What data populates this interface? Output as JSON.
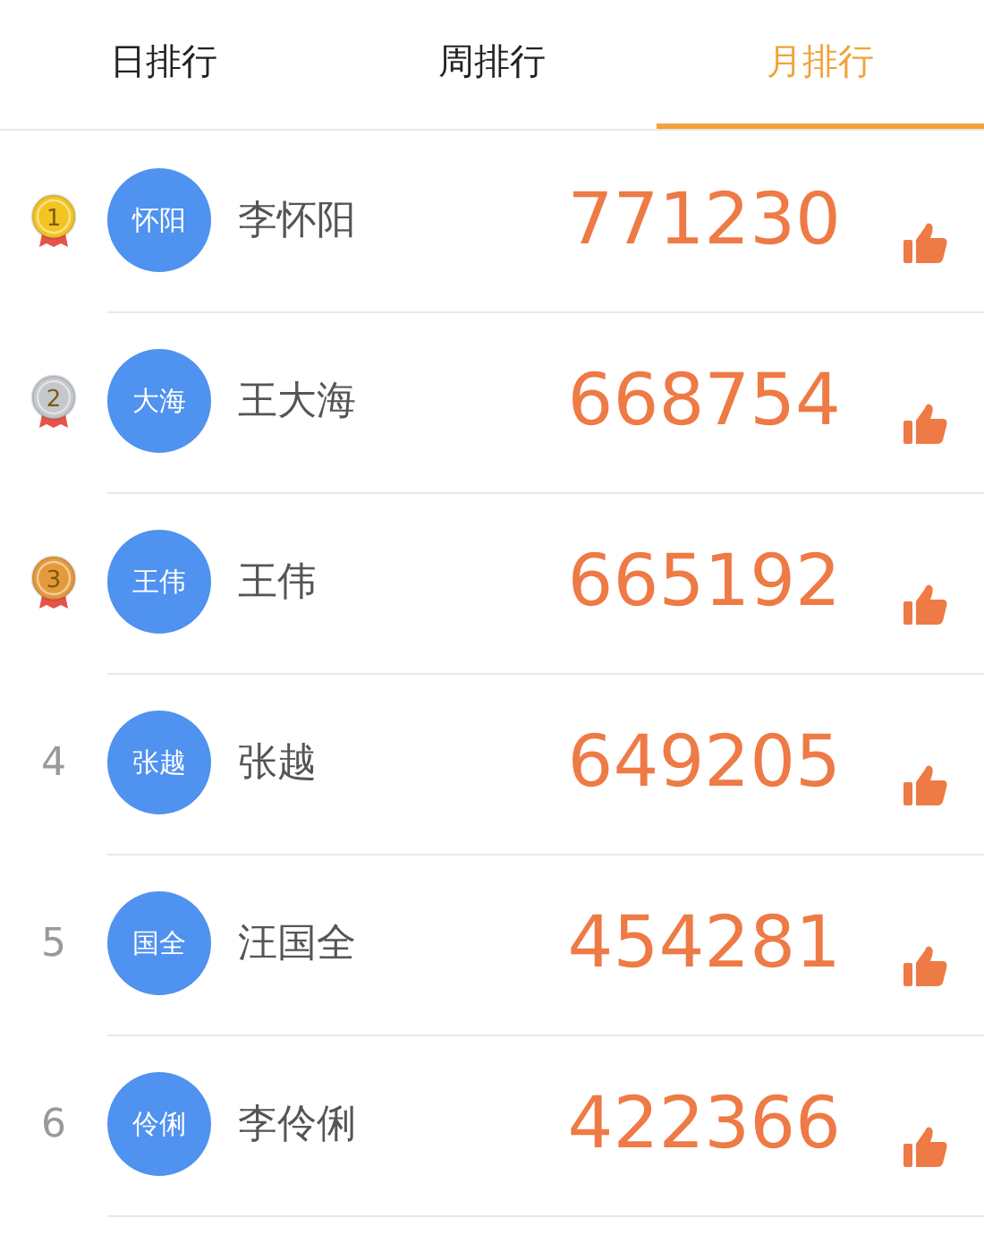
{
  "tabs": [
    {
      "label": "日排行",
      "selected": false
    },
    {
      "label": "周排行",
      "selected": false
    },
    {
      "label": "月排行",
      "selected": true
    }
  ],
  "rows": [
    {
      "kind": "medal",
      "rank": "1",
      "color": "#f2c522",
      "avatar": "怀阳",
      "name": "李怀阳",
      "score": "771230"
    },
    {
      "kind": "medal",
      "rank": "2",
      "color": "#c4c8cc",
      "avatar": "大海",
      "name": "王大海",
      "score": "668754"
    },
    {
      "kind": "medal",
      "rank": "3",
      "color": "#e49a3c",
      "avatar": "王伟",
      "name": "王伟",
      "score": "665192"
    },
    {
      "kind": "plain",
      "rank": "4",
      "avatar": "张越",
      "name": "张越",
      "score": "649205"
    },
    {
      "kind": "plain",
      "rank": "5",
      "avatar": "国全",
      "name": "汪国全",
      "score": "454281"
    },
    {
      "kind": "plain",
      "rank": "6",
      "avatar": "伶俐",
      "name": "李伶俐",
      "score": "422366"
    }
  ]
}
